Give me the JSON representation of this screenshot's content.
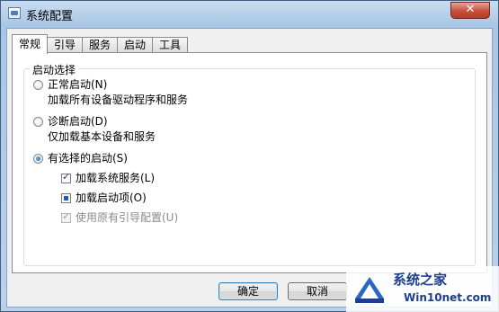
{
  "window": {
    "title": "系统配置",
    "close_label": "✕"
  },
  "tabs": [
    {
      "label": "常规",
      "active": true
    },
    {
      "label": "引导",
      "active": false
    },
    {
      "label": "服务",
      "active": false
    },
    {
      "label": "启动",
      "active": false
    },
    {
      "label": "工具",
      "active": false
    }
  ],
  "startup": {
    "legend": "启动选择",
    "options": [
      {
        "label": "正常启动(N)",
        "desc": "加载所有设备驱动程序和服务",
        "selected": false
      },
      {
        "label": "诊断启动(D)",
        "desc": "仅加载基本设备和服务",
        "selected": false
      },
      {
        "label": "有选择的启动(S)",
        "selected": true
      }
    ],
    "selective": [
      {
        "label": "加载系统服务(L)",
        "state": "checked",
        "enabled": true
      },
      {
        "label": "加载启动项(O)",
        "state": "mixed",
        "enabled": true
      },
      {
        "label": "使用原有引导配置(U)",
        "state": "checked",
        "enabled": false
      }
    ]
  },
  "buttons": {
    "ok": "确定",
    "cancel": "取消"
  },
  "watermark": {
    "title": "系统之家",
    "url": "Win10net.com"
  },
  "colors": {
    "accent": "#1a5bb0",
    "close": "#c7503a",
    "watermark": "#1c3f8f"
  }
}
